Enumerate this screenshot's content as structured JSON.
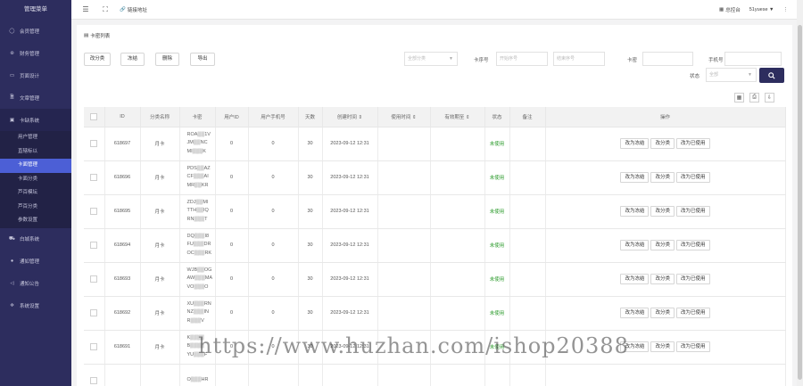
{
  "sidebar": {
    "title": "管理菜单",
    "items": [
      {
        "label": "会员管理",
        "icon": "user-icon"
      },
      {
        "label": "财务管理",
        "icon": "coin-icon"
      },
      {
        "label": "页面设计",
        "icon": "layout-icon"
      },
      {
        "label": "文章管理",
        "icon": "document-icon"
      },
      {
        "label": "卡缺系统",
        "icon": "card-system-icon"
      }
    ],
    "subitems": [
      "用户管理",
      "直辖标以",
      "卡面管理",
      "卡面分类",
      "芦百模坛",
      "芦百分类",
      "参数设置"
    ],
    "active_sub": 2,
    "items_after": [
      {
        "label": "白城系统",
        "icon": "cart-icon"
      },
      {
        "label": "通如管理",
        "icon": "circle-icon"
      },
      {
        "label": "通知公告",
        "icon": "megaphone-icon"
      },
      {
        "label": "系统设置",
        "icon": "settings-icon"
      }
    ]
  },
  "topbar": {
    "link_label": "链接地址",
    "dashboard_label": "总控台",
    "user_label": "51yuese ▼",
    "more": "⋮"
  },
  "panel": {
    "title": "卡密列表",
    "buttons": [
      "改分类",
      "冻结",
      "删除",
      "导出"
    ],
    "filters": {
      "category_placeholder": "全部分类",
      "card_no_label": "卡序号",
      "start_placeholder": "开始序号",
      "end_placeholder": "结束序号",
      "card_label": "卡密",
      "phone_label": "手机号",
      "status_label": "状态",
      "status_value": "全部"
    }
  },
  "table": {
    "headers": [
      "ID",
      "分类名称",
      "卡密",
      "用户ID",
      "用户手机号",
      "天数",
      "创建时间 ⇕",
      "使用时间 ⇕",
      "有效期至 ⇕",
      "状态",
      "备注",
      "操作"
    ],
    "rows": [
      {
        "id": "618697",
        "category": "月卡",
        "card": [
          "ROA▒▒1V",
          "JM▒▒NC",
          "MI▒▒▒K"
        ],
        "uid": "0",
        "phone": "0",
        "days": "30",
        "created": "2023-09-12 12:31",
        "used": "",
        "expire": "",
        "status": "未使用",
        "note": "",
        "actions": [
          "改为冻结",
          "改分类",
          "改为已使用"
        ]
      },
      {
        "id": "618696",
        "category": "月卡",
        "card": [
          "PDS▒▒AZ",
          "CF▒▒▒AI",
          "MR▒▒KR"
        ],
        "uid": "0",
        "phone": "0",
        "days": "30",
        "created": "2023-09-12 12:31",
        "used": "",
        "expire": "",
        "status": "未使用",
        "note": "",
        "actions": [
          "改为冻结",
          "改分类",
          "改为已使用"
        ]
      },
      {
        "id": "618695",
        "category": "月卡",
        "card": [
          "ZDJ▒▒MI",
          "TTH▒▒IQ",
          "RN▒▒▒T"
        ],
        "uid": "0",
        "phone": "0",
        "days": "30",
        "created": "2023-09-12 12:31",
        "used": "",
        "expire": "",
        "status": "未使用",
        "note": "",
        "actions": [
          "改为冻结",
          "改分类",
          "改为已使用"
        ]
      },
      {
        "id": "618694",
        "category": "月卡",
        "card": [
          "DQ▒▒▒I8",
          "FU▒▒▒DR",
          "OC▒▒▒RK"
        ],
        "uid": "0",
        "phone": "0",
        "days": "30",
        "created": "2023-09-12 12:31",
        "used": "",
        "expire": "",
        "status": "未使用",
        "note": "",
        "actions": [
          "改为冻结",
          "改分类",
          "改为已使用"
        ]
      },
      {
        "id": "618693",
        "category": "月卡",
        "card": [
          "WJB▒▒OG",
          "AW▒▒▒MA",
          "VO▒▒▒O"
        ],
        "uid": "0",
        "phone": "0",
        "days": "30",
        "created": "2023-09-12 12:31",
        "used": "",
        "expire": "",
        "status": "未使用",
        "note": "",
        "actions": [
          "改为冻结",
          "改分类",
          "改为已使用"
        ]
      },
      {
        "id": "618692",
        "category": "月卡",
        "card": [
          "XU▒▒▒RN",
          "NZ▒▒▒IN",
          "R▒▒▒V"
        ],
        "uid": "0",
        "phone": "0",
        "days": "30",
        "created": "2023-09-12 12:31",
        "used": "",
        "expire": "",
        "status": "未使用",
        "note": "",
        "actions": [
          "改为冻结",
          "改分类",
          "改为已使用"
        ]
      },
      {
        "id": "618691",
        "category": "月卡",
        "card": [
          "K▒▒▒▒",
          "B▒▒▒▒",
          "YU▒▒▒F"
        ],
        "uid": "0",
        "phone": "0",
        "days": "30",
        "created": "2023-09-12 12:31",
        "used": "",
        "expire": "",
        "status": "未使用",
        "note": "",
        "actions": [
          "改为冻结",
          "改分类",
          "改为已使用"
        ]
      },
      {
        "id": "",
        "category": "",
        "card": [
          "O▒▒▒HR",
          "",
          ""
        ],
        "uid": "",
        "phone": "",
        "days": "",
        "created": "",
        "used": "",
        "expire": "",
        "status": "",
        "note": "",
        "actions": []
      }
    ]
  },
  "watermark": "https://www.huzhan.com/ishop20388",
  "colors": {
    "sidebar_bg": "#2d2d5e",
    "active": "#4c5fd6",
    "status_green": "#2a9a2a"
  }
}
